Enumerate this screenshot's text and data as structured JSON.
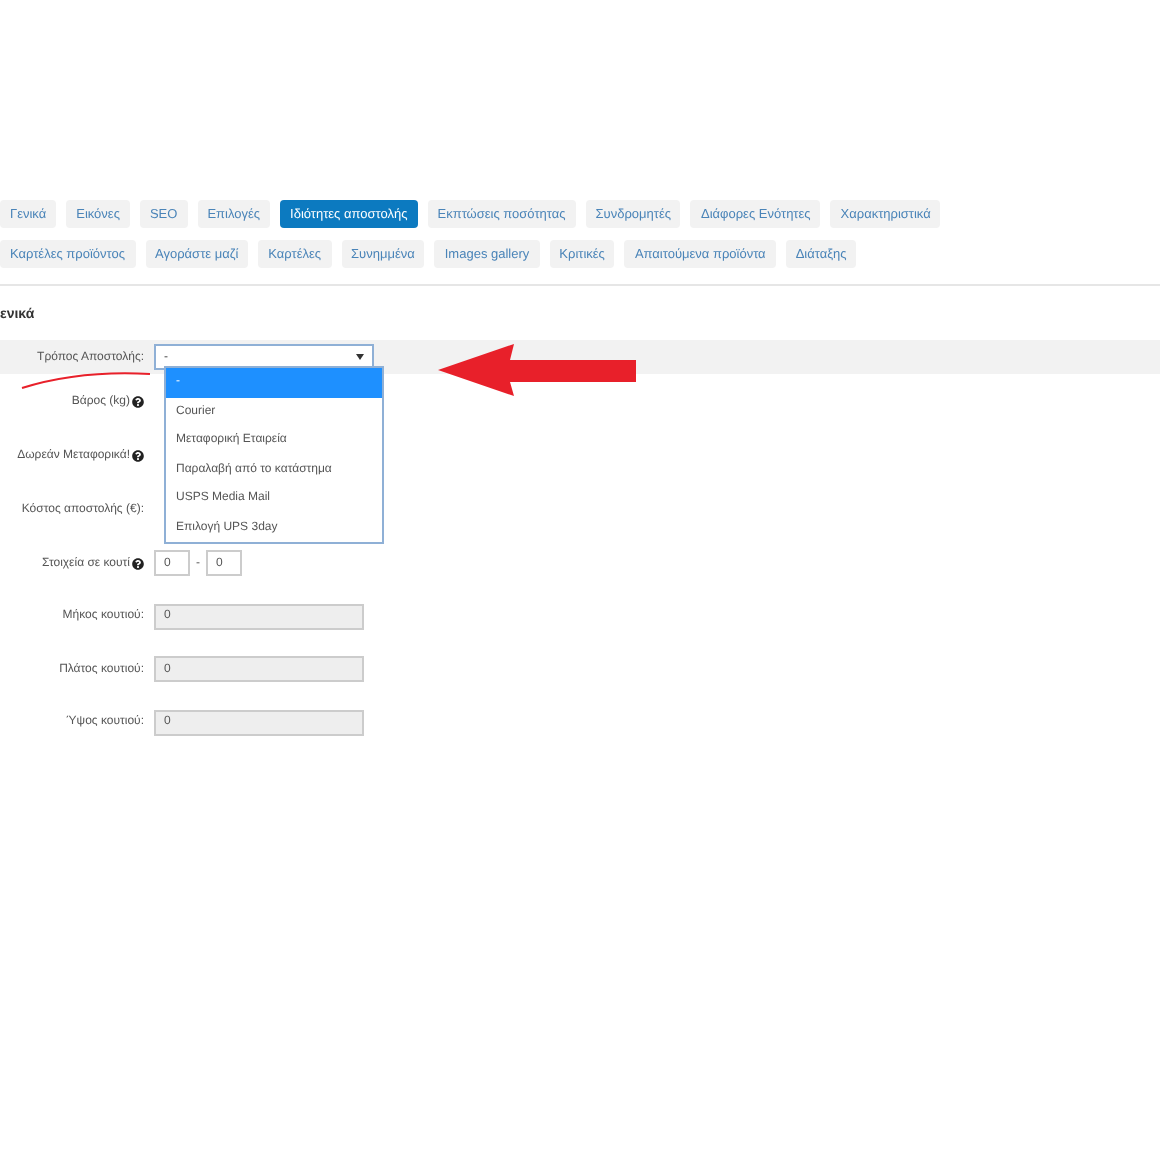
{
  "tabs": [
    {
      "label": "Γενικά",
      "selected": false
    },
    {
      "label": "Εικόνες",
      "selected": false
    },
    {
      "label": "SEO",
      "selected": false
    },
    {
      "label": "Επιλογές",
      "selected": false
    },
    {
      "label": "Ιδιότητες αποστολής",
      "selected": true
    },
    {
      "label": "Εκπτώσεις ποσότητας",
      "selected": false
    },
    {
      "label": "Συνδρομητές",
      "selected": false
    },
    {
      "label": "Διάφορες Ενότητες",
      "selected": false
    },
    {
      "label": "Χαρακτηριστικά",
      "selected": false
    },
    {
      "label": "Καρτέλες προϊόντος",
      "selected": false
    },
    {
      "label": "Αγοράστε μαζί",
      "selected": false
    },
    {
      "label": "Καρτέλες",
      "selected": false
    },
    {
      "label": "Συνημμένα",
      "selected": false
    },
    {
      "label": "Images gallery",
      "selected": false
    },
    {
      "label": "Κριτικές",
      "selected": false
    },
    {
      "label": "Απαιτούμενα προϊόντα",
      "selected": false
    },
    {
      "label": "Διάταξης",
      "selected": false
    }
  ],
  "section_title": "ενικά",
  "fields": [
    {
      "kind": "select",
      "label": "Τρόπος Αποστολής:",
      "value": "-",
      "help": false,
      "expanded": true,
      "options": [
        {
          "label": "-",
          "selected": true
        },
        {
          "label": "Courier",
          "selected": false
        },
        {
          "label": "Μεταφορική Εταιρεία",
          "selected": false
        },
        {
          "label": "Παραλαβή από το κατάστημα",
          "selected": false
        },
        {
          "label": "USPS Media Mail",
          "selected": false
        },
        {
          "label": "Επιλογή UPS 3day",
          "selected": false
        }
      ]
    },
    {
      "kind": "hidden",
      "label": "Βάρος (kg)",
      "help": true
    },
    {
      "kind": "hidden",
      "label": "Δωρεάν Μεταφορικά!",
      "help": true
    },
    {
      "kind": "hidden",
      "label": "Κόστος αποστολής (€):",
      "help": false
    },
    {
      "kind": "range",
      "label": "Στοιχεία σε κουτί",
      "help": true,
      "from": "0",
      "separator": "-",
      "to": "0"
    },
    {
      "kind": "text",
      "label": "Μήκος κουτιού:",
      "value": "0",
      "help": false,
      "disabled": true
    },
    {
      "kind": "text",
      "label": "Πλάτος κουτιού:",
      "value": "0",
      "help": false,
      "disabled": true
    },
    {
      "kind": "text",
      "label": "Ύψος κουτιού:",
      "value": "0",
      "help": false,
      "disabled": true
    }
  ]
}
